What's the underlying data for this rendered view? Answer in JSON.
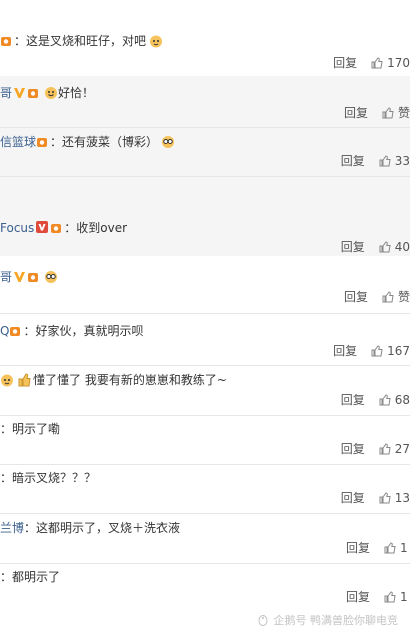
{
  "comments": [
    {
      "text": "：这是叉烧和旺仔，对吧",
      "reply_label": "回复",
      "likes": "170"
    },
    {
      "text": "好恰！",
      "reply_label": "回复",
      "likes": "赞"
    },
    {
      "user": "信篮球",
      "text": "：还有菠菜（博彩）",
      "reply_label": "回复",
      "likes": "33"
    },
    {
      "user": "Focus",
      "text": "：收到over",
      "reply_label": "回复",
      "likes": "40"
    },
    {
      "text": "",
      "reply_label": "回复",
      "likes": "赞"
    },
    {
      "user": "Q",
      "text": "：好家伙，真就明示呗",
      "reply_label": "回复",
      "likes": "167"
    },
    {
      "text": "懂了懂了 我要有新的崽崽和教练了~",
      "reply_label": "回复",
      "likes": "68"
    },
    {
      "text": "：明示了嘞",
      "reply_label": "回复",
      "likes": "27"
    },
    {
      "text": "：暗示叉烧？？？",
      "reply_label": "回复",
      "likes": "13"
    },
    {
      "user": "兰博",
      "text": "：这都明示了，叉烧＋洗衣液",
      "reply_label": "回复",
      "likes": "1"
    },
    {
      "text": "：都明示了",
      "reply_label": "回复",
      "likes": "1"
    }
  ],
  "watermark": "企鹅号 鸭满兽脸你聊电竞"
}
